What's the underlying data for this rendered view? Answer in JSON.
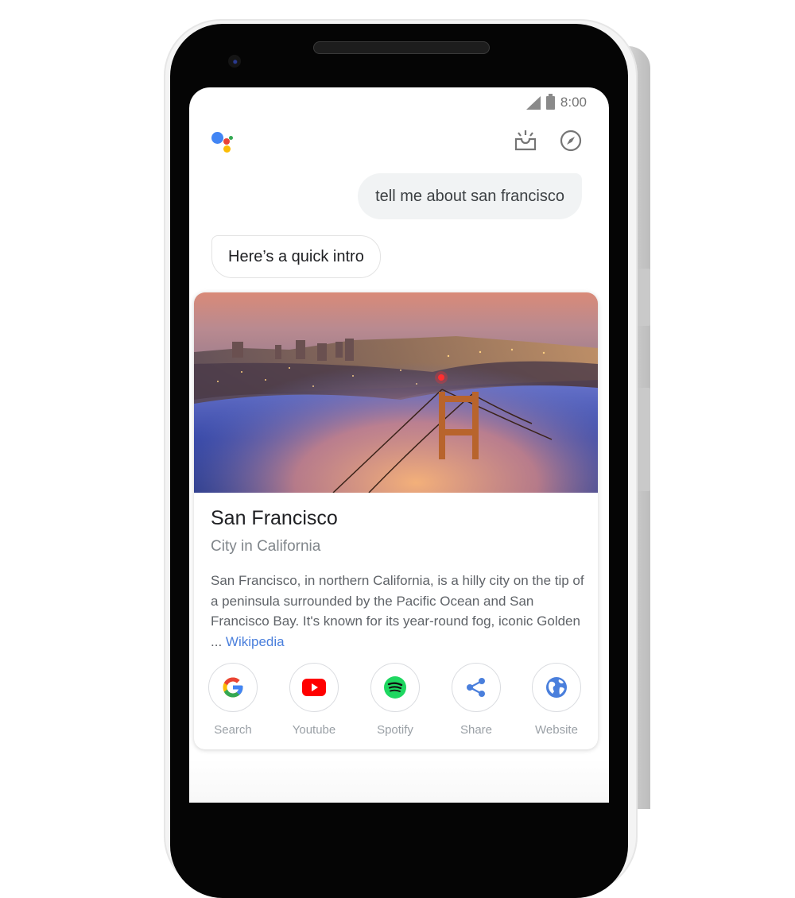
{
  "device": {
    "accent_button_color": "#f08a55"
  },
  "statusbar": {
    "time": "8:00",
    "signal_icon": "cell-signal-icon",
    "battery_icon": "battery-icon"
  },
  "header": {
    "logo": "google-assistant-logo",
    "updates_icon": "inbox-updates-icon",
    "explore_icon": "compass-explore-icon"
  },
  "conversation": {
    "user_query": "tell me about san francisco",
    "assistant_reply": "Here’s a quick intro"
  },
  "card": {
    "image_alt": "Golden Gate Bridge in fog with San Francisco skyline at dusk",
    "title": "San Francisco",
    "subtitle": "City in California",
    "description": "San Francisco, in northern California, is a hilly city on the tip of a peninsula surrounded by the Pacific Ocean and San Francisco Bay. It's known for its year-round fog, iconic Golden ... ",
    "source_link": "Wikipedia",
    "link_color": "#4a7fdc",
    "actions": [
      {
        "label": "Search",
        "icon": "google-g-icon"
      },
      {
        "label": "Youtube",
        "icon": "youtube-icon"
      },
      {
        "label": "Spotify",
        "icon": "spotify-icon"
      },
      {
        "label": "Share",
        "icon": "share-icon"
      },
      {
        "label": "Website",
        "icon": "globe-icon"
      }
    ]
  },
  "colors": {
    "google_blue": "#4285f4",
    "google_red": "#ea4335",
    "google_yellow": "#fbbc05",
    "google_green": "#34a853",
    "youtube_red": "#ff0000",
    "spotify_green": "#1ed760"
  }
}
